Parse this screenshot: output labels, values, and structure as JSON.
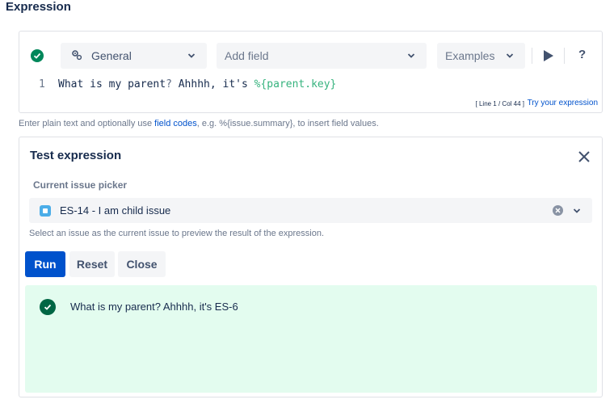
{
  "section": {
    "title": "Expression"
  },
  "toolbar": {
    "general_label": "General",
    "add_field_label": "Add field",
    "examples_label": "Examples",
    "help_label": "?"
  },
  "editor": {
    "line_number": "1",
    "code_plain": "What is my parent",
    "code_q": "?",
    "code_mid": " Ahhhh, it's ",
    "code_key": "%{parent.key}",
    "cursor_info": "[ Line 1 / Col 44 ]",
    "try_label": "Try your expression"
  },
  "helper": {
    "prefix": "Enter plain text and optionally use ",
    "link": "field codes",
    "suffix": ", e.g. %{issue.summary}, to insert field values."
  },
  "test": {
    "title": "Test expression",
    "picker_label": "Current issue picker",
    "picker_value": "ES-14 - I am child issue",
    "picker_help": "Select an issue as the current issue to preview the result of the expression.",
    "run_label": "Run",
    "reset_label": "Reset",
    "close_label": "Close",
    "result_text": "What is my parent? Ahhhh, it's ES-6"
  },
  "colors": {
    "success": "#00875a",
    "primary": "#0052cc",
    "result_bg": "#e3fcef",
    "field_key": "#36b37e"
  }
}
